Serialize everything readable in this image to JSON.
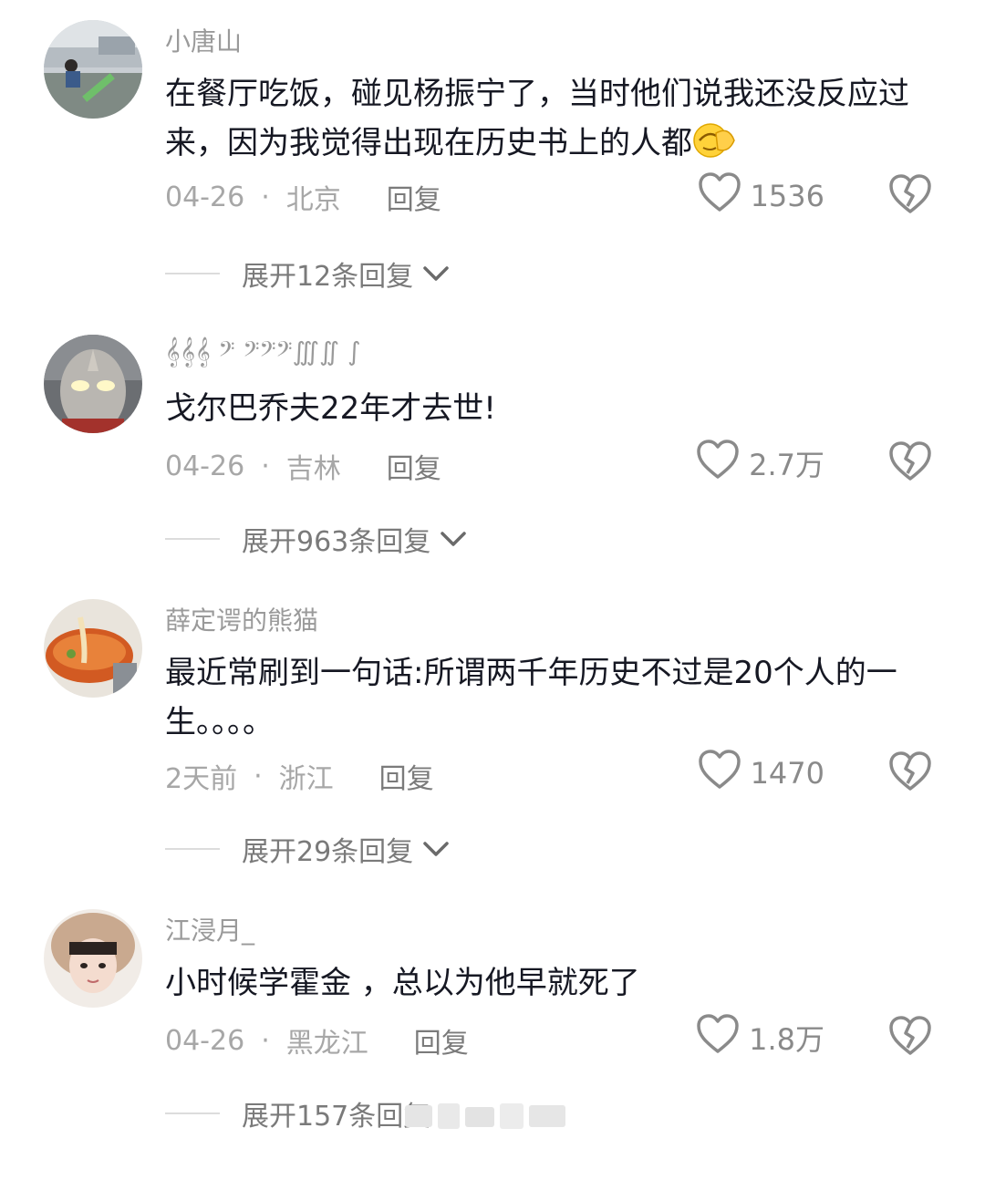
{
  "comments": [
    {
      "username": "小唐山",
      "text": "在餐厅吃饭，碰见杨振宁了，当时他们说我还没反应过来，因为我觉得出现在历史书上的人都",
      "emoji": "face-with-hand-over-eyes",
      "date": "04-26",
      "location": "北京",
      "reply_label": "回复",
      "likes": "1536",
      "expand_label": "展开12条回复"
    },
    {
      "username": "𝄞𝄞𝄞 𝄢 𝄢𝄢𝄢∭∬ ∫",
      "text": "戈尔巴乔夫22年才去世!",
      "date": "04-26",
      "location": "吉林",
      "reply_label": "回复",
      "likes": "2.7万",
      "expand_label": "展开963条回复"
    },
    {
      "username": "薛定谔的熊猫",
      "text": "最近常刷到一句话:所谓两千年历史不过是20个人的一生。。。。",
      "date": "2天前",
      "location": "浙江",
      "reply_label": "回复",
      "likes": "1470",
      "expand_label": "展开29条回复"
    },
    {
      "username": "江浸月_",
      "text": "小时候学霍金 ，总以为他早就死了",
      "date": "04-26",
      "location": "黑龙江",
      "reply_label": "回复",
      "likes": "1.8万",
      "expand_label": "展开157条回复"
    }
  ],
  "icons": {
    "like": "heart-outline-icon",
    "dislike": "broken-heart-icon",
    "expand": "chevron-down-icon"
  },
  "colors": {
    "text": "#161823",
    "meta": "#a7a7a7",
    "username": "#9a9a9a"
  }
}
